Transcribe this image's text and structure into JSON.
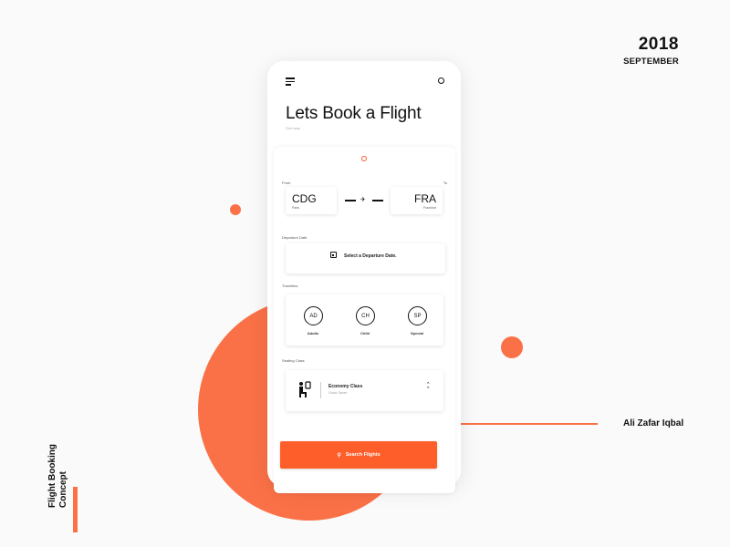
{
  "header": {
    "year": "2018",
    "month": "SEPTEMBER"
  },
  "side": {
    "concept_title": "Flight Booking Concept"
  },
  "author": {
    "name": "Ali Zafar Iqbal"
  },
  "colors": {
    "accent": "#fb7147",
    "button": "#fe5e29",
    "background": "#fafafa"
  },
  "app": {
    "menu_icon": "hamburger-menu",
    "profile_icon": "circle-outline",
    "title": "Lets Book a Flight",
    "subtitle": "One way",
    "from": {
      "label": "From",
      "code": "CDG",
      "city": "Paris"
    },
    "to": {
      "label": "To",
      "code": "FRA",
      "city": "Frankfurt"
    },
    "route_icon": "plane",
    "departure": {
      "label": "Departure Date",
      "placeholder": "Select a Departure Date.",
      "icon": "calendar"
    },
    "travellers": {
      "label": "Travellers",
      "items": [
        {
          "code": "AD",
          "label": "Adults"
        },
        {
          "code": "CH",
          "label": "Child"
        },
        {
          "code": "SP",
          "label": "Special"
        }
      ]
    },
    "seating": {
      "label": "Seating Class",
      "class_name": "Economy Class",
      "class_desc": "Good Saver",
      "icon": "seated-passenger"
    },
    "search_button": {
      "label": "Search Flights",
      "icon": "search"
    }
  }
}
